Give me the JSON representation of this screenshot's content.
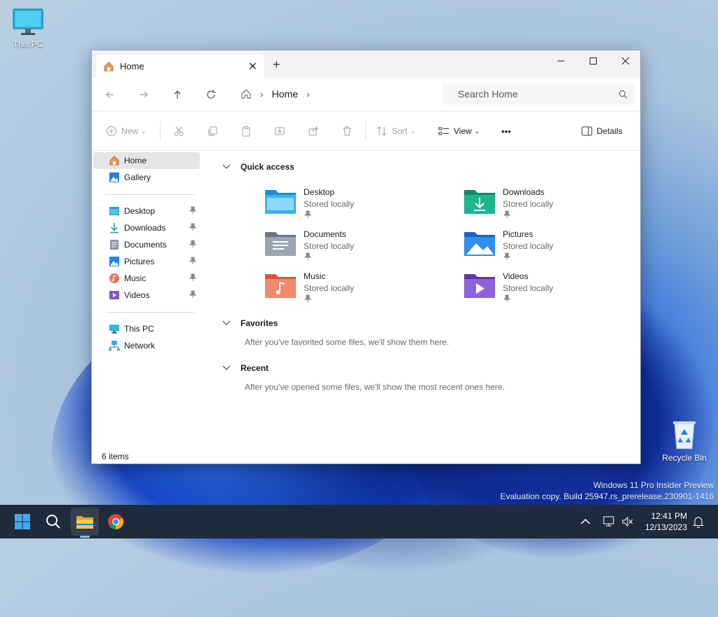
{
  "desktop": {
    "icons": [
      {
        "label": "This PC"
      },
      {
        "label": "Recycle Bin"
      }
    ],
    "watermark_line1": "Windows 11 Pro Insider Preview",
    "watermark_line2": "Evaluation copy. Build 25947.rs_prerelease.230901-1416"
  },
  "window": {
    "tab_title": "Home",
    "new_tab_symbol": "+",
    "address": {
      "segments": [
        "Home"
      ]
    },
    "search": {
      "placeholder": "Search Home"
    },
    "commands": {
      "new_label": "New",
      "sort_label": "Sort",
      "view_label": "View",
      "more_symbol": "•••",
      "details_label": "Details"
    },
    "sidebar": {
      "top": [
        {
          "label": "Home",
          "icon": "home-icon",
          "selected": true
        },
        {
          "label": "Gallery",
          "icon": "gallery-icon"
        }
      ],
      "pinned": [
        {
          "label": "Desktop",
          "icon": "desktop-folder-icon"
        },
        {
          "label": "Downloads",
          "icon": "downloads-icon"
        },
        {
          "label": "Documents",
          "icon": "documents-icon"
        },
        {
          "label": "Pictures",
          "icon": "pictures-icon"
        },
        {
          "label": "Music",
          "icon": "music-icon"
        },
        {
          "label": "Videos",
          "icon": "videos-icon"
        }
      ],
      "locations": [
        {
          "label": "This PC",
          "icon": "this-pc-icon"
        },
        {
          "label": "Network",
          "icon": "network-icon"
        }
      ]
    },
    "content": {
      "quick_access": {
        "heading": "Quick access",
        "items": [
          {
            "name": "Desktop",
            "sub": "Stored locally",
            "color": "#1a8fd6"
          },
          {
            "name": "Downloads",
            "sub": "Stored locally",
            "color": "#16a085"
          },
          {
            "name": "Documents",
            "sub": "Stored locally",
            "color": "#7b8794"
          },
          {
            "name": "Pictures",
            "sub": "Stored locally",
            "color": "#1e88e5"
          },
          {
            "name": "Music",
            "sub": "Stored locally",
            "color": "#e8735a"
          },
          {
            "name": "Videos",
            "sub": "Stored locally",
            "color": "#7e57c2"
          }
        ]
      },
      "favorites": {
        "heading": "Favorites",
        "empty_text": "After you've favorited some files, we'll show them here."
      },
      "recent": {
        "heading": "Recent",
        "empty_text": "After you've opened some files, we'll show the most recent ones here."
      }
    },
    "status": {
      "items_count": "6 items"
    }
  },
  "taskbar": {
    "clock_time": "12:41 PM",
    "clock_date": "12/13/2023"
  }
}
